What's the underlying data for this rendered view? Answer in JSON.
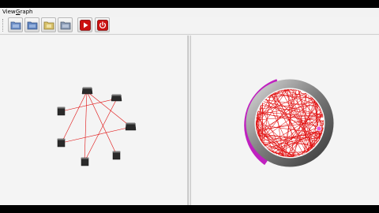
{
  "menu": {
    "view_label": "View",
    "graph_label_first": "G",
    "graph_label_rest": "raph"
  },
  "toolbar": {
    "buttons": [
      {
        "name": "open-graph-button",
        "icon": "folder-blue-icon"
      },
      {
        "name": "save-graph-button",
        "icon": "folder-blue-icon"
      },
      {
        "name": "load-graph-button",
        "icon": "folder-yellow-icon"
      },
      {
        "name": "export-graph-button",
        "icon": "folder-gray-icon"
      },
      {
        "name": "run-button",
        "icon": "play-icon"
      },
      {
        "name": "stop-button",
        "icon": "power-icon"
      }
    ]
  },
  "colors": {
    "edge": "#e01010",
    "node": "#2a2a2a",
    "ring_magenta": "#c020c0",
    "ring_gray": "#6a6a6a",
    "play_red": "#cc1111",
    "power_red": "#cc1111"
  }
}
